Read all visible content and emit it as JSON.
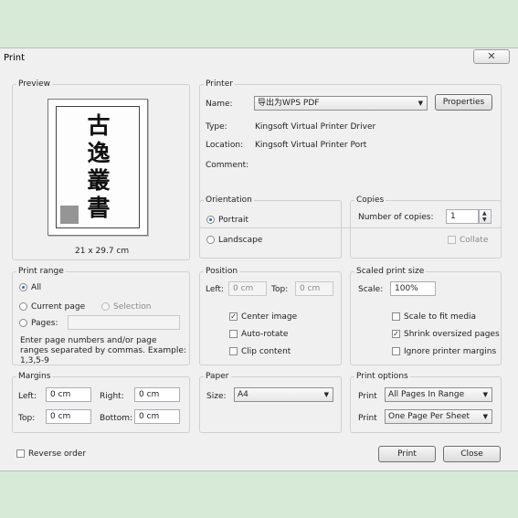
{
  "dialog": {
    "title": "Print",
    "close_label": "✕"
  },
  "preview": {
    "legend": "Preview",
    "page_size": "21 x 29.7 cm",
    "calligraphy": [
      "古",
      "逸",
      "叢",
      "書"
    ]
  },
  "printer": {
    "legend": "Printer",
    "name_label": "Name:",
    "name_value": "导出为WPS PDF",
    "properties_label": "Properties",
    "type_label": "Type:",
    "type_value": "Kingsoft Virtual Printer Driver",
    "location_label": "Location:",
    "location_value": "Kingsoft Virtual Printer Port",
    "comment_label": "Comment:"
  },
  "orientation": {
    "legend": "Orientation",
    "portrait": "Portrait",
    "landscape": "Landscape",
    "selected": "Portrait"
  },
  "copies": {
    "legend": "Copies",
    "number_label": "Number of copies:",
    "number_value": "1",
    "collate_label": "Collate"
  },
  "print_range": {
    "legend": "Print range",
    "all": "All",
    "current_page": "Current page",
    "selection": "Selection",
    "pages": "Pages:",
    "selected": "All",
    "hint": "Enter page numbers and/or page ranges separated by commas. Example: 1,3,5-9"
  },
  "position": {
    "legend": "Position",
    "left_label": "Left:",
    "left_value": "0 cm",
    "top_label": "Top:",
    "top_value": "0 cm",
    "center_image": "Center image",
    "center_image_checked": true,
    "auto_rotate": "Auto-rotate",
    "auto_rotate_checked": false,
    "clip_content": "Clip content",
    "clip_content_checked": false
  },
  "scaled": {
    "legend": "Scaled print size",
    "scale_label": "Scale:",
    "scale_value": "100%",
    "fit_media": "Scale to fit media",
    "fit_media_checked": false,
    "shrink": "Shrink oversized pages",
    "shrink_checked": true,
    "ignore_margins": "Ignore printer margins",
    "ignore_margins_checked": false
  },
  "margins": {
    "legend": "Margins",
    "left_label": "Left:",
    "left_value": "0 cm",
    "right_label": "Right:",
    "right_value": "0 cm",
    "top_label": "Top:",
    "top_value": "0 cm",
    "bottom_label": "Bottom:",
    "bottom_value": "0 cm"
  },
  "paper": {
    "legend": "Paper",
    "size_label": "Size:",
    "size_value": "A4"
  },
  "print_options": {
    "legend": "Print options",
    "print_label": "Print",
    "range_value": "All Pages In Range",
    "per_sheet_value": "One Page Per Sheet"
  },
  "footer": {
    "reverse_order": "Reverse order",
    "print_button": "Print",
    "close_button": "Close"
  },
  "colors": {
    "background": "#d7ead7",
    "dialog": "#f0f0f0",
    "accent": "#2a6ebd"
  },
  "icons": {
    "dropdown": "chevron-down-icon",
    "spin": "spin-arrows-icon",
    "check": "checkmark-icon"
  }
}
